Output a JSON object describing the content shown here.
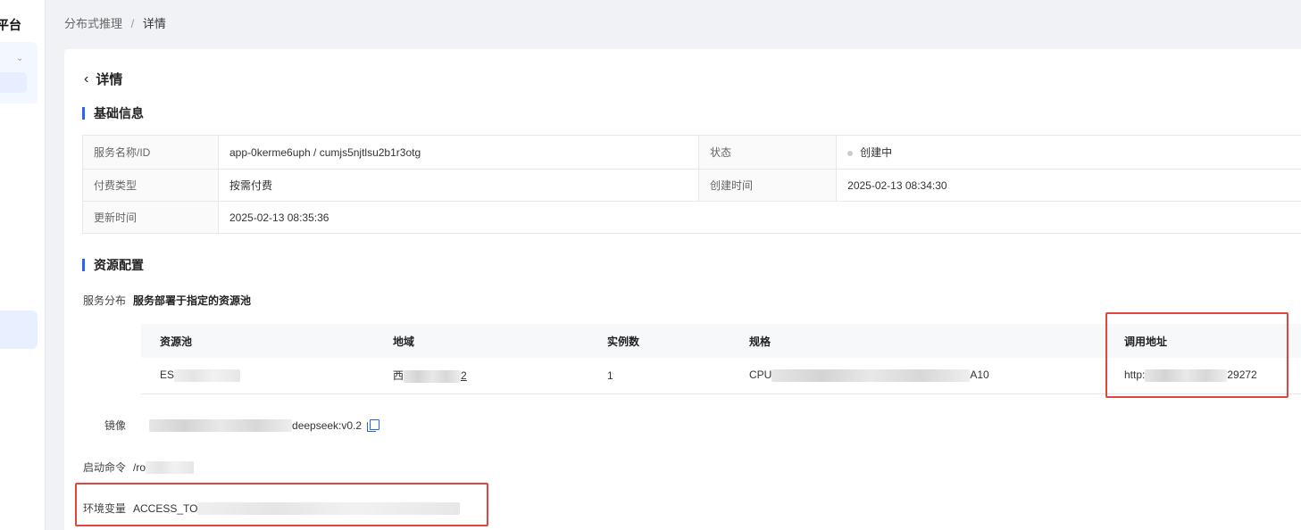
{
  "sidebar": {
    "brand_fragment": "平台",
    "chevron": "⌄"
  },
  "breadcrumb": {
    "parent": "分布式推理",
    "separator": "/",
    "current": "详情"
  },
  "header": {
    "back_icon": "‹",
    "title": "详情"
  },
  "basic_info": {
    "section_title": "基础信息",
    "rows": [
      {
        "k1": "服务名称/ID",
        "v1": "app-0kerme6uph / cumjs5njtlsu2b1r3otg",
        "k2": "状态",
        "v2": "创建中"
      },
      {
        "k1": "付费类型",
        "v1": "按需付费",
        "k2": "创建时间",
        "v2": "2025-02-13 08:34:30"
      },
      {
        "k1": "更新时间",
        "v1": "2025-02-13 08:35:36"
      }
    ]
  },
  "resource": {
    "section_title": "资源配置",
    "distribution_label": "服务分布",
    "distribution_value": "服务部署于指定的资源池",
    "table": {
      "headers": [
        "资源池",
        "地域",
        "实例数",
        "规格",
        "调用地址"
      ],
      "row": {
        "pool_prefix": "ES",
        "region_prefix": "西",
        "region_suffix": "2",
        "instances": "1",
        "spec_prefix": "CPU",
        "spec_suffix": "A10",
        "url_prefix": "http:",
        "url_suffix": "29272"
      }
    },
    "image_label": "镜像",
    "image_value_suffix": "deepseek:v0.2",
    "startup_label": "启动命令",
    "startup_value_prefix": "/ro",
    "env_label": "环境变量",
    "env_value_prefix": "ACCESS_TO"
  },
  "colors": {
    "accent": "#2468f2",
    "highlight_box": "#e0463d"
  }
}
